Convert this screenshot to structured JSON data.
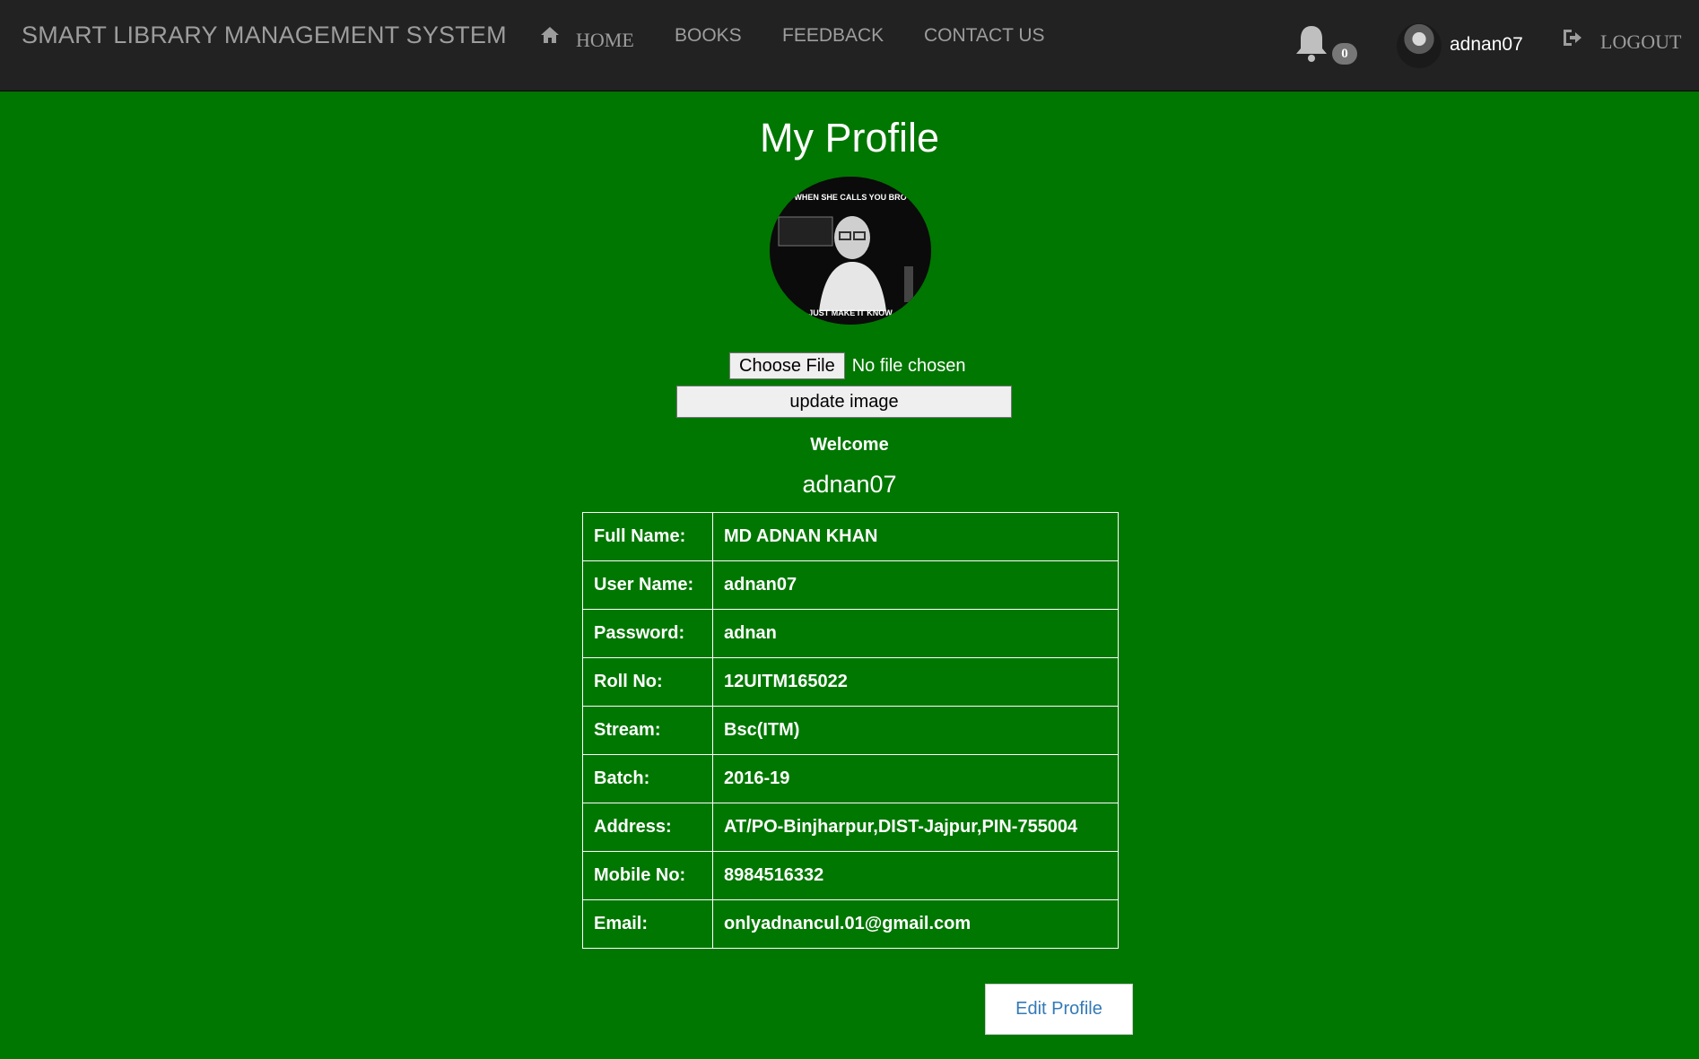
{
  "navbar": {
    "brand": "SMART LIBRARY MANAGEMENT SYSTEM",
    "items": [
      {
        "label": "HOME",
        "icon": "home-icon"
      },
      {
        "label": "BOOKS"
      },
      {
        "label": "FEEDBACK"
      },
      {
        "label": "CONTACT US"
      }
    ],
    "notifications": {
      "icon": "bell-icon",
      "count": "0"
    },
    "user": {
      "name": "adnan07",
      "avatar": "avatar"
    },
    "logout": {
      "label": "LOGOUT",
      "icon": "logout-icon"
    }
  },
  "main": {
    "title": "My Profile",
    "profile_image_text": {
      "top": "WHEN SHE CALLS YOU BRO",
      "bottom": "JUST MAKE IT KNOW"
    },
    "file_input": {
      "button_label": "Choose File",
      "status": "No file chosen"
    },
    "update_button": "update image",
    "welcome": "Welcome",
    "username": "adnan07",
    "details": [
      {
        "label": "Full Name:",
        "value": "MD ADNAN KHAN"
      },
      {
        "label": "User Name:",
        "value": "adnan07"
      },
      {
        "label": "Password:",
        "value": "adnan"
      },
      {
        "label": "Roll No:",
        "value": "12UITM165022"
      },
      {
        "label": "Stream:",
        "value": "Bsc(ITM)"
      },
      {
        "label": "Batch:",
        "value": "2016-19"
      },
      {
        "label": "Address:",
        "value": "AT/PO-Binjharpur,DIST-Jajpur,PIN-755004"
      },
      {
        "label": "Mobile No:",
        "value": "8984516332"
      },
      {
        "label": "Email:",
        "value": "onlyadnancul.01@gmail.com"
      }
    ],
    "edit_button": "Edit Profile"
  },
  "colors": {
    "background": "#007700",
    "navbar": "#222222",
    "nav_text": "#9d9d9d",
    "edit_button_text": "#337ab7"
  }
}
